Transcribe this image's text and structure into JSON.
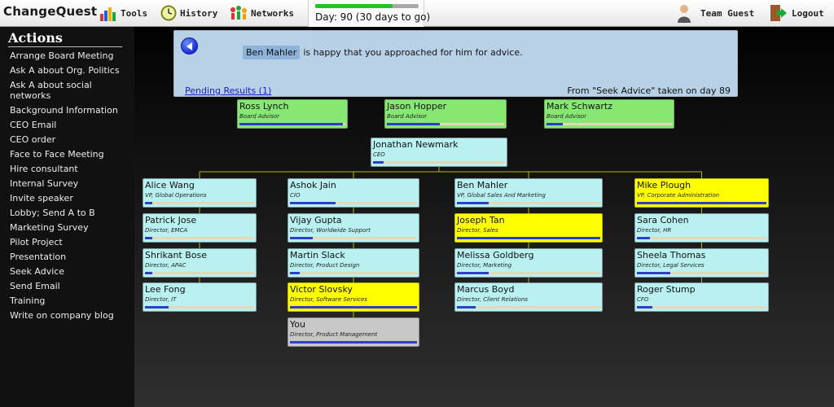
{
  "app": {
    "logo": "ChangeQuest"
  },
  "nav": [
    {
      "label": "Tools",
      "icon": "tools-chart-icon"
    },
    {
      "label": "History",
      "icon": "clock-icon"
    },
    {
      "label": "Networks",
      "icon": "networks-icon"
    }
  ],
  "day": {
    "text": "Day: 90 (30 days to go)",
    "progress": 0.75
  },
  "user": {
    "label": "Team Guest",
    "icon": "person-icon"
  },
  "logout": {
    "label": "Logout",
    "icon": "logout-door-icon"
  },
  "sidebar": {
    "title": "Actions",
    "items": [
      "Arrange Board Meeting",
      "Ask A about Org. Politics",
      "Ask A about social networks",
      "Background Information",
      "CEO Email",
      "CEO order",
      "Face to Face Meeting",
      "Hire consultant",
      "Internal Survey",
      "Invite speaker",
      "Lobby; Send A to B",
      "Marketing Survey",
      "Pilot Project",
      "Presentation",
      "Seek Advice",
      "Send Email",
      "Training",
      "Write on company blog"
    ]
  },
  "message": {
    "name": "Ben Mahler",
    "text": "is happy that you approached for him for advice.",
    "pending": "Pending Results (1)",
    "source": "From \"Seek Advice\" taken on day 89"
  },
  "org": {
    "advisors": [
      {
        "name": "Ross Lynch",
        "title": "Board Advisor",
        "color": "green",
        "progress": 0.98
      },
      {
        "name": "Jason Hopper",
        "title": "Board Advisor",
        "color": "green",
        "progress": 0.45
      },
      {
        "name": "Mark Schwartz",
        "title": "Board Advisor",
        "color": "green",
        "progress": 0.13
      }
    ],
    "ceo": {
      "name": "Jonathan Newmark",
      "title": "CEO",
      "color": "teal",
      "progress": 0.08
    },
    "columns": [
      [
        {
          "name": "Alice Wang",
          "title": "VP, Global Operations",
          "color": "teal",
          "progress": 0.07
        },
        {
          "name": "Patrick Jose",
          "title": "Director, EMCA",
          "color": "teal",
          "progress": 0.07
        },
        {
          "name": "Shrikant Bose",
          "title": "Director, APAC",
          "color": "teal",
          "progress": 0.07
        },
        {
          "name": "Lee Fong",
          "title": "Director, IT",
          "color": "teal",
          "progress": 0.22
        }
      ],
      [
        {
          "name": "Ashok Jain",
          "title": "CIO",
          "color": "teal",
          "progress": 0.36
        },
        {
          "name": "Vijay Gupta",
          "title": "Director, Worldwide Support",
          "color": "teal",
          "progress": 0.18
        },
        {
          "name": "Martin Slack",
          "title": "Director, Product Design",
          "color": "teal",
          "progress": 0.08
        },
        {
          "name": "Victor Slovsky",
          "title": "Director, Software Services",
          "color": "yellow",
          "progress": 1.0
        },
        {
          "name": "You",
          "title": "Director, Product Management",
          "color": "gray",
          "progress": 1.0
        }
      ],
      [
        {
          "name": "Ben Mahler",
          "title": "VP, Global Sales And Marketing",
          "color": "teal",
          "progress": 0.22
        },
        {
          "name": "Joseph Tan",
          "title": "Director, Sales",
          "color": "yellow",
          "progress": 1.0
        },
        {
          "name": "Melissa Goldberg",
          "title": "Director, Marketing",
          "color": "teal",
          "progress": 0.22
        },
        {
          "name": "Marcus Boyd",
          "title": "Director, Client Relations",
          "color": "teal",
          "progress": 0.13
        }
      ],
      [
        {
          "name": "Mike Plough",
          "title": "VP, Corporate Administration",
          "color": "yellow",
          "progress": 1.0
        },
        {
          "name": "Sara Cohen",
          "title": "Director, HR",
          "color": "teal",
          "progress": 0.1
        },
        {
          "name": "Sheela Thomas",
          "title": "Director, Legal Services",
          "color": "teal",
          "progress": 0.26
        },
        {
          "name": "Roger Stump",
          "title": "CFO",
          "color": "teal",
          "progress": 0.12
        }
      ]
    ]
  }
}
